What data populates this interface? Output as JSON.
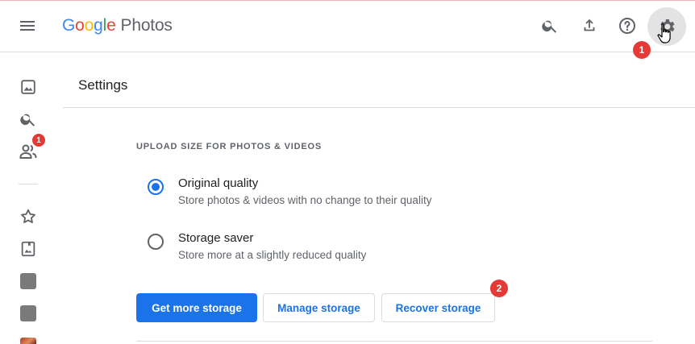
{
  "header": {
    "logo": {
      "g1": "G",
      "g2": "o",
      "g3": "o",
      "g4": "g",
      "g5": "l",
      "g6": "e",
      "product": "Photos"
    },
    "icons": [
      "menu-icon",
      "search-icon",
      "upload-icon",
      "help-icon",
      "settings-icon"
    ]
  },
  "annotations": {
    "step1": "1",
    "step2": "2"
  },
  "sidebar": {
    "sharing_badge": "1",
    "items": [
      "photos-icon",
      "search-icon",
      "sharing-icon",
      "star-icon",
      "album-icon",
      "album-thumb",
      "album-thumb",
      "album-thumb"
    ]
  },
  "settings": {
    "title": "Settings",
    "section_label": "UPLOAD SIZE FOR PHOTOS & VIDEOS",
    "options": [
      {
        "title": "Original quality",
        "description": "Store photos & videos with no change to their quality",
        "selected": true
      },
      {
        "title": "Storage saver",
        "description": "Store more at a slightly reduced quality",
        "selected": false
      }
    ],
    "buttons": {
      "get_more": "Get more storage",
      "manage": "Manage storage",
      "recover": "Recover storage"
    }
  },
  "colors": {
    "accent": "#1a73e8",
    "badge": "#e53935",
    "divider": "#dadce0"
  }
}
